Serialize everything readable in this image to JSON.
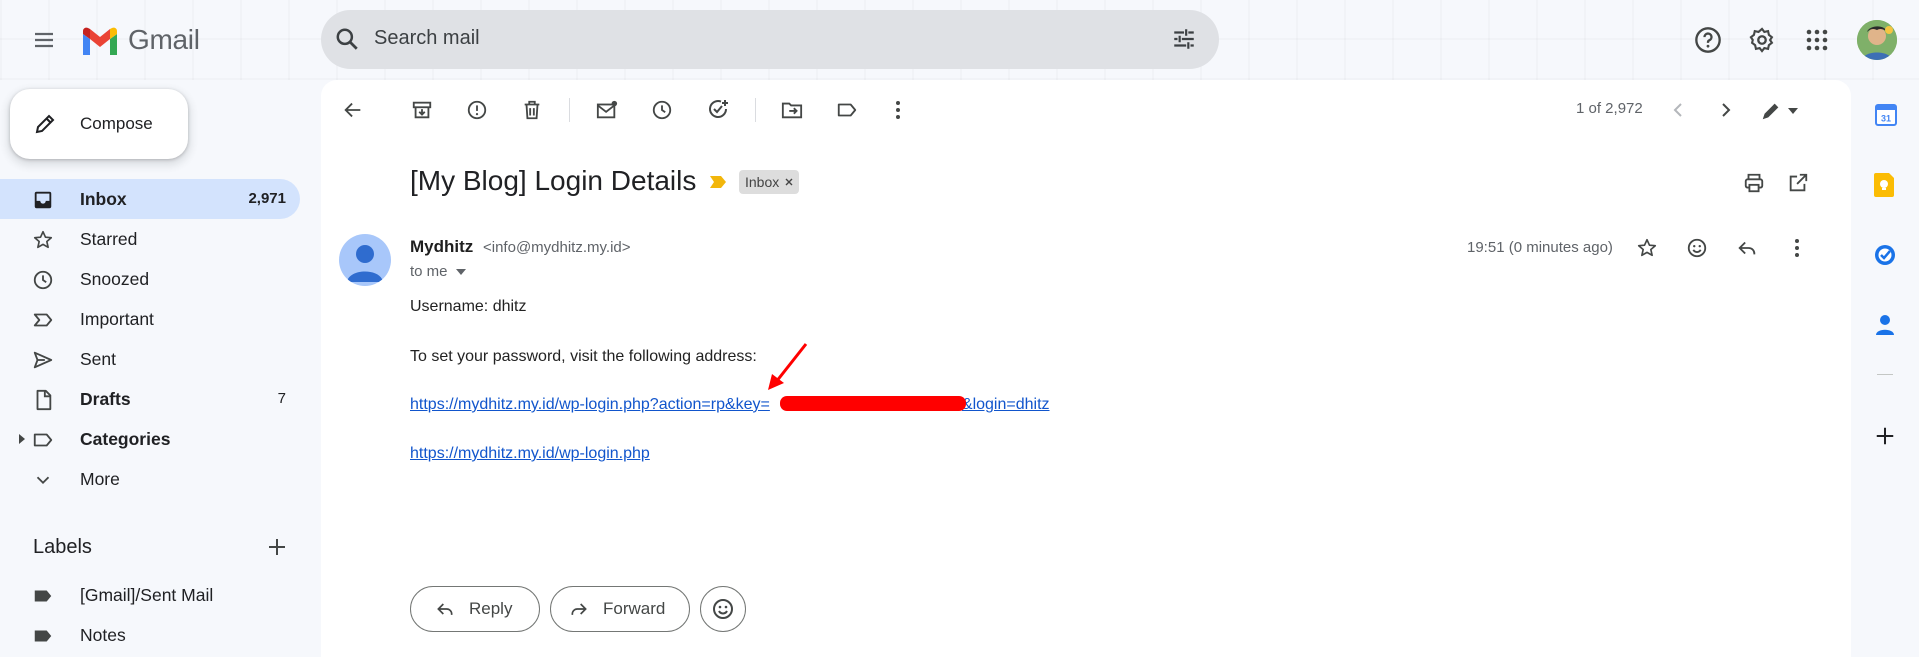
{
  "app": {
    "name": "Gmail"
  },
  "search": {
    "placeholder": "Search mail"
  },
  "sidebar": {
    "compose_label": "Compose",
    "items": [
      {
        "label": "Inbox",
        "count": "2,971",
        "icon": "inbox-icon"
      },
      {
        "label": "Starred",
        "count": "",
        "icon": "star-icon"
      },
      {
        "label": "Snoozed",
        "count": "",
        "icon": "clock-icon"
      },
      {
        "label": "Important",
        "count": "",
        "icon": "important-icon"
      },
      {
        "label": "Sent",
        "count": "",
        "icon": "send-icon"
      },
      {
        "label": "Drafts",
        "count": "7",
        "icon": "draft-icon"
      },
      {
        "label": "Categories",
        "count": "",
        "icon": "label-icon"
      },
      {
        "label": "More",
        "count": "",
        "icon": "chevron-down-icon"
      }
    ],
    "labels_title": "Labels",
    "labels": [
      {
        "label": "[Gmail]/Sent Mail"
      },
      {
        "label": "Notes"
      }
    ]
  },
  "toolbar": {
    "pager": "1 of 2,972"
  },
  "email": {
    "subject": "[My Blog] Login Details",
    "tag": "Inbox",
    "sender_name": "Mydhitz",
    "sender_email": "<info@mydhitz.my.id>",
    "to": "to me",
    "time": "19:51 (0 minutes ago)",
    "body": {
      "username_line": "Username: dhitz",
      "instruction": "To set your password, visit the following address:",
      "reset_link_start": "https://mydhitz.my.id/wp-login.php?action=rp&key=",
      "reset_link_end": "&login=dhitz",
      "login_link": "https://mydhitz.my.id/wp-login.php"
    },
    "actions": {
      "reply": "Reply",
      "forward": "Forward"
    }
  },
  "colors": {
    "accent": "#0b57d0",
    "active_nav": "#d3e3fd",
    "link": "#1155cc",
    "annotation_red": "#ff0000"
  }
}
